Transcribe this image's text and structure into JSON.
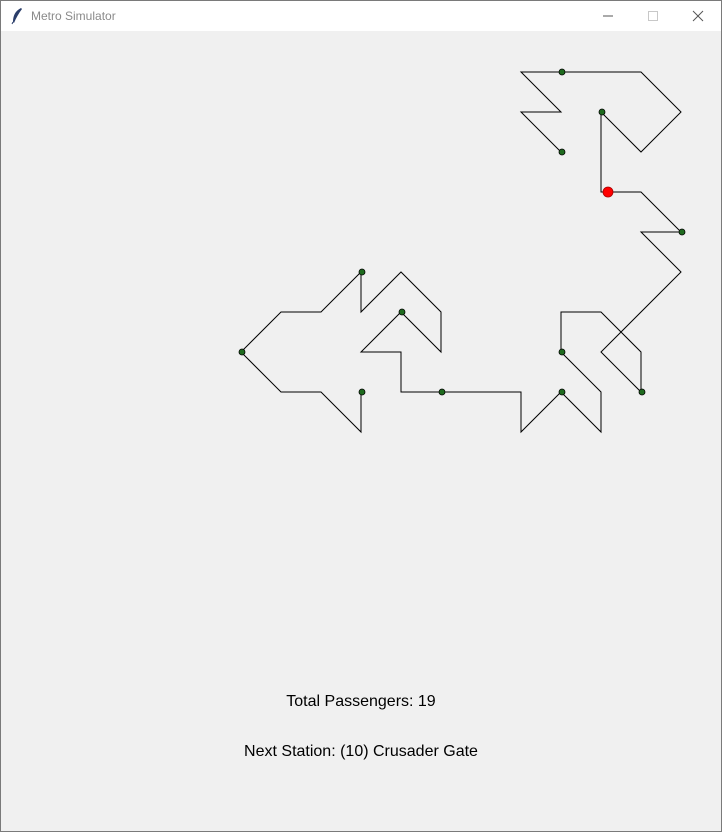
{
  "window": {
    "title": "Metro Simulator",
    "app_icon": "feather-icon",
    "controls": {
      "minimize": "minimize-icon",
      "maximize": "maximize-icon",
      "close": "close-icon"
    }
  },
  "map": {
    "line_color": "#000000",
    "station_color": "#1e6b1e",
    "train_color": "#ff0000"
  },
  "status": {
    "total_passengers": "Total Passengers: 19",
    "next_station": "Next Station: (10) Crusader Gate"
  }
}
